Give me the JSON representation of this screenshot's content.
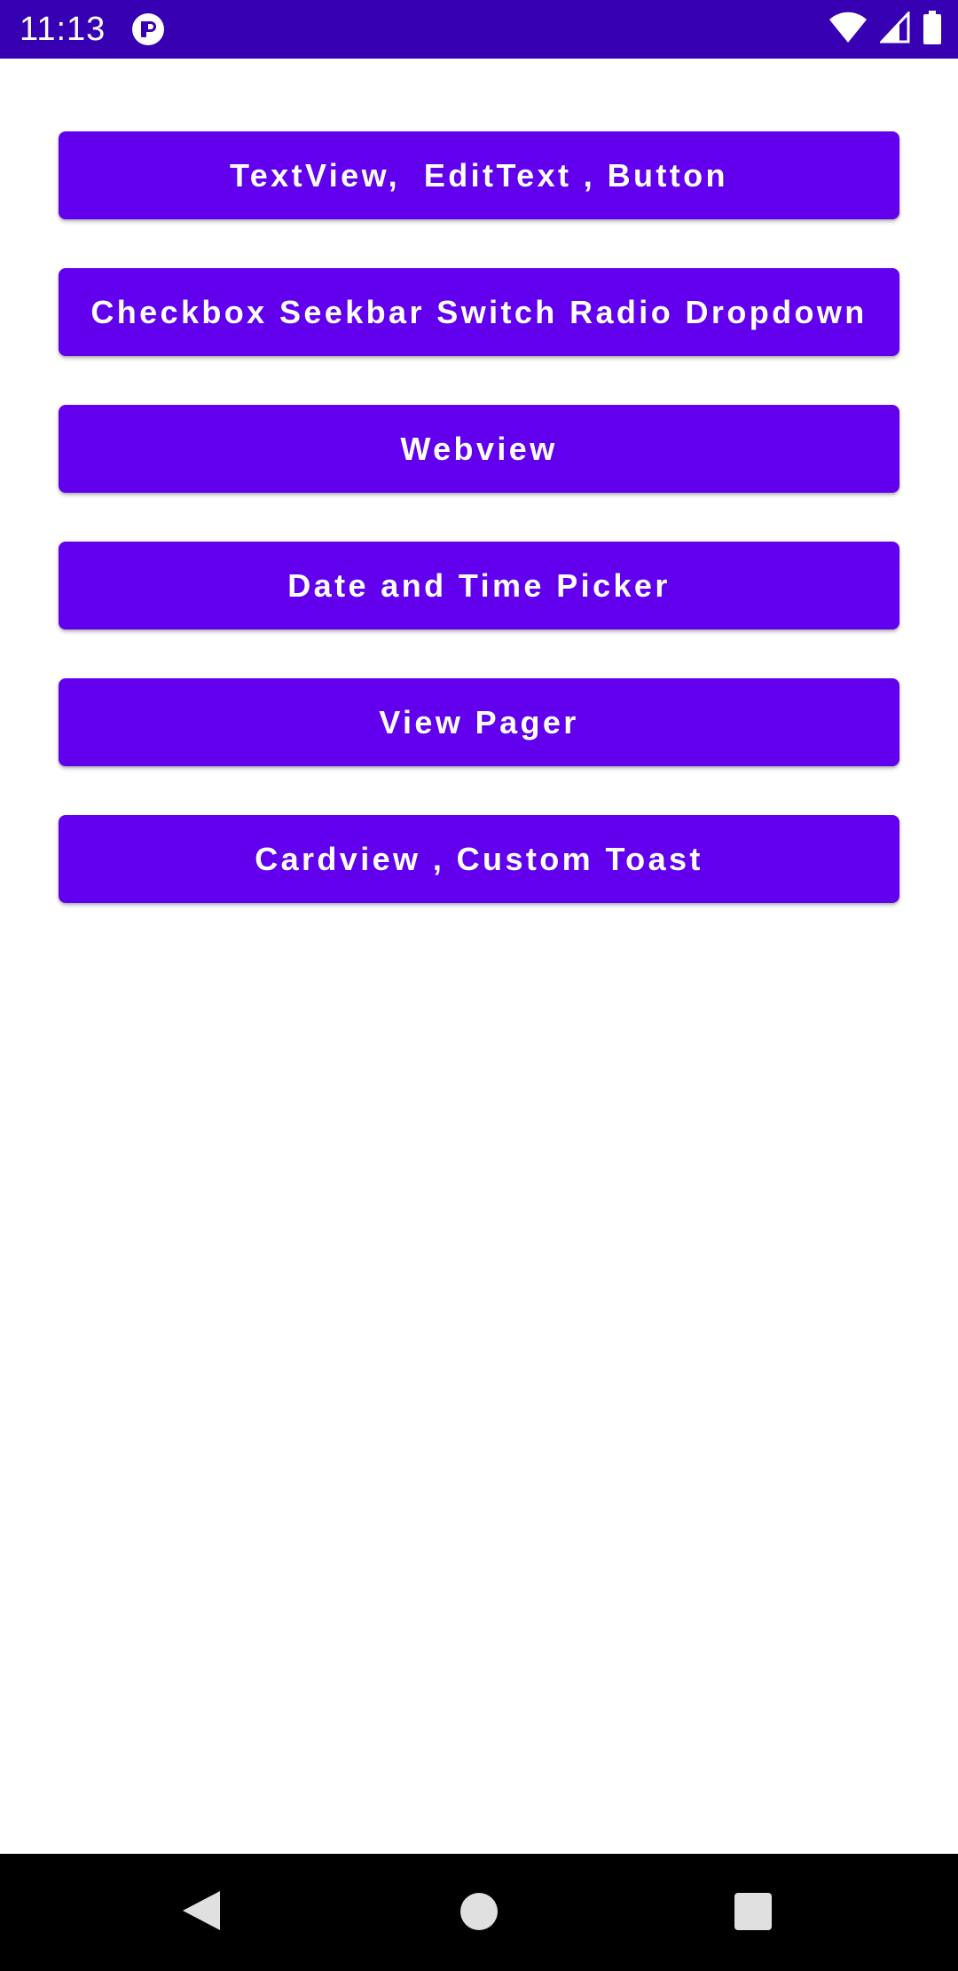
{
  "status_bar": {
    "time": "11:13",
    "background": "#3700b3",
    "app_icon": "app-notification-icon",
    "wifi_icon": "wifi-icon",
    "signal_icon": "cell-signal-icon",
    "battery_icon": "battery-icon"
  },
  "buttons": [
    {
      "label": "TextView,  EditText , Button"
    },
    {
      "label": "Checkbox Seekbar Switch Radio Dropdown"
    },
    {
      "label": "Webview"
    },
    {
      "label": "Date and Time Picker"
    },
    {
      "label": "View Pager"
    },
    {
      "label": "Cardview , Custom Toast"
    }
  ],
  "colors": {
    "button": "#6200ee",
    "button_text": "#ffffff",
    "status_bar": "#3700b3",
    "nav_bar": "#000000"
  },
  "nav_bar": {
    "back_icon": "back-triangle-icon",
    "home_icon": "home-circle-icon",
    "recents_icon": "recents-square-icon"
  }
}
